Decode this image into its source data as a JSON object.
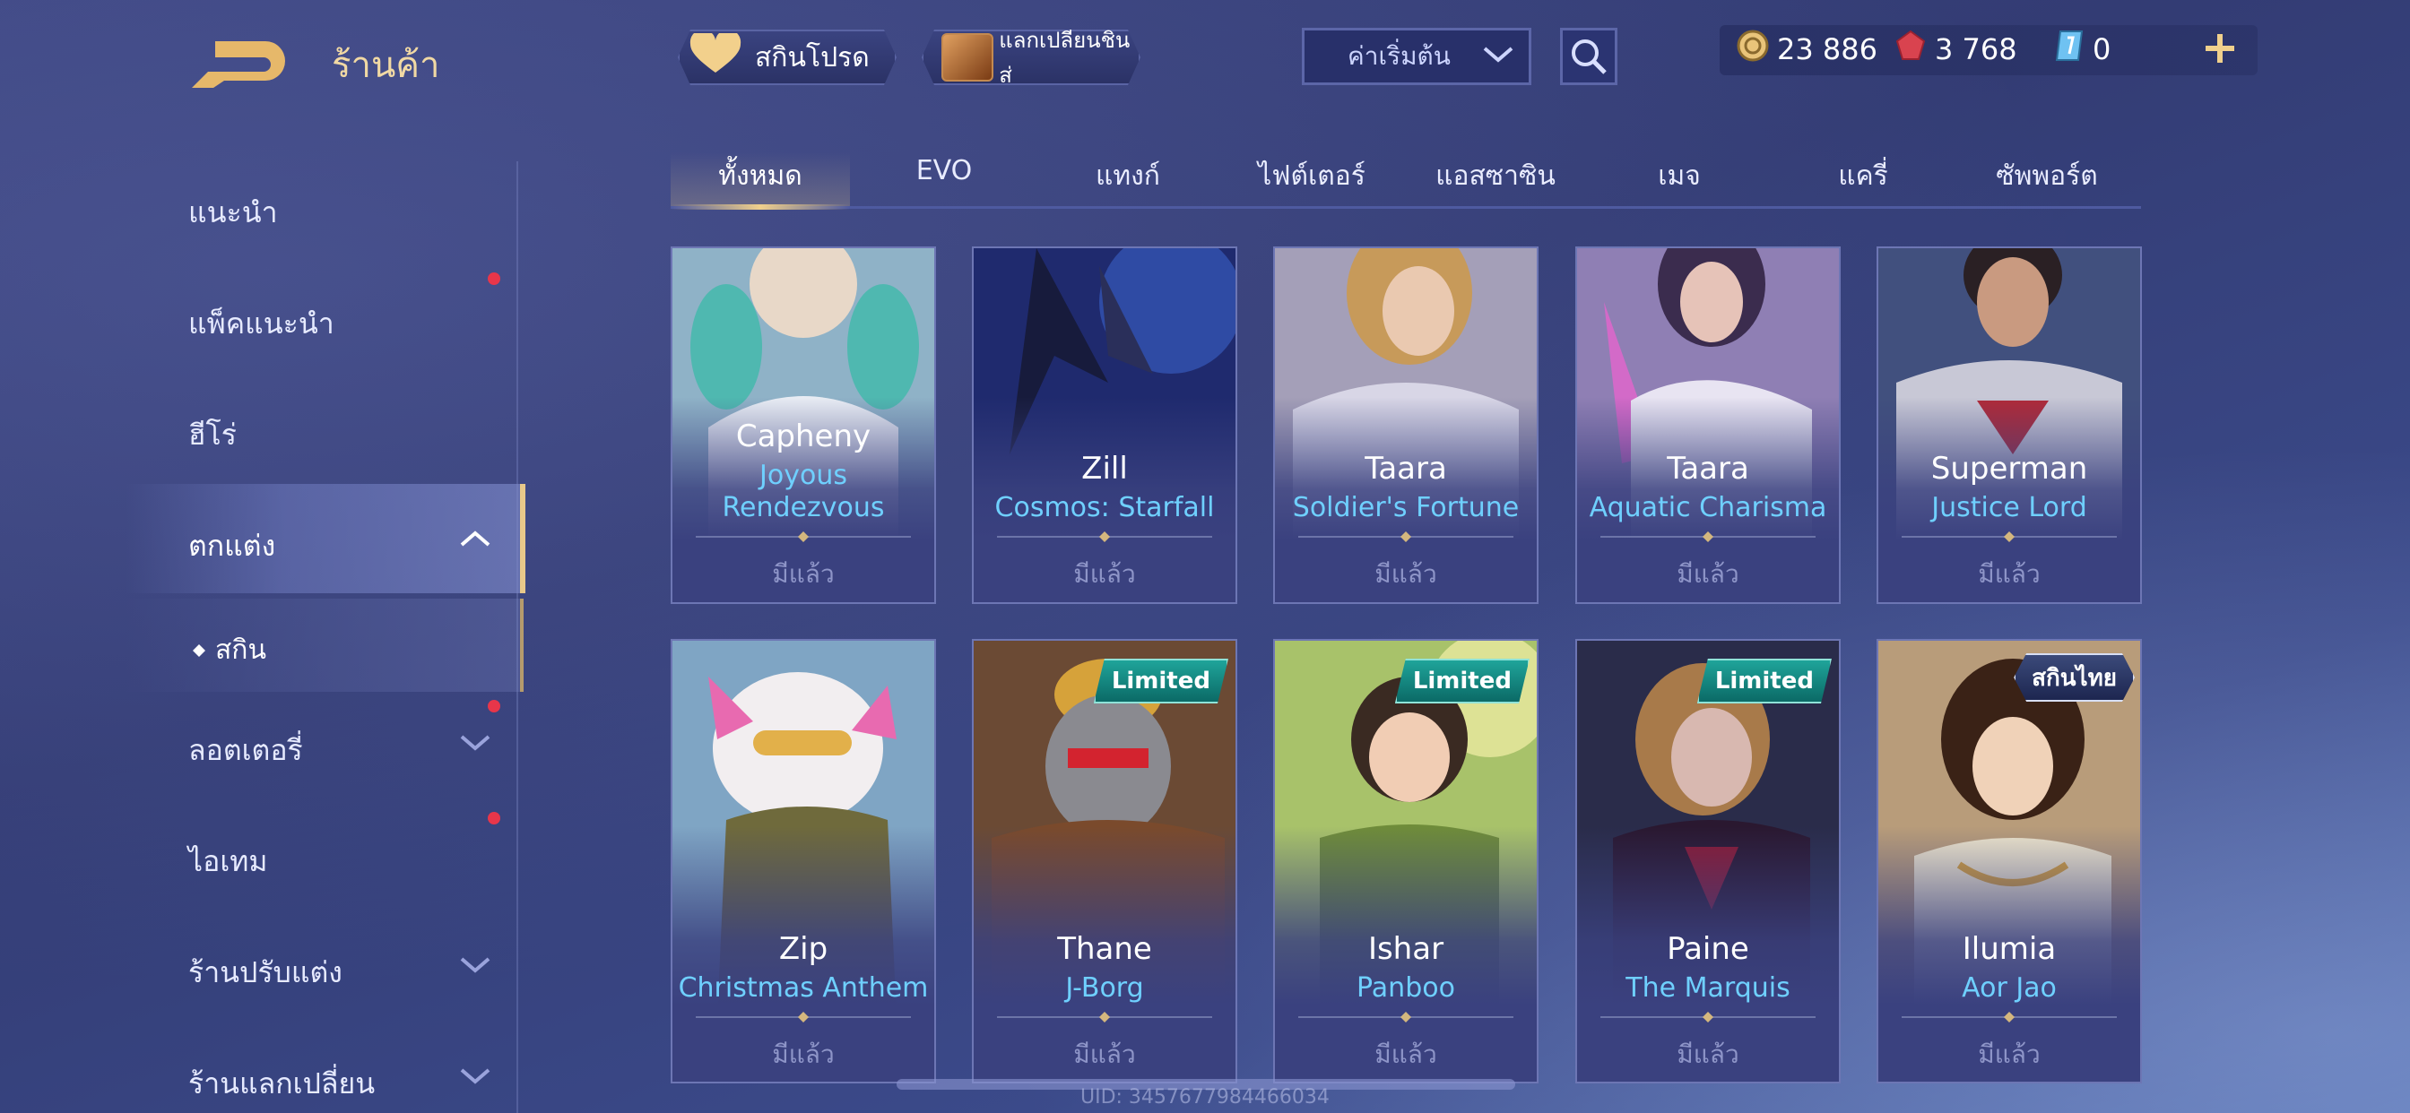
{
  "header": {
    "title": "ร้านค้า",
    "skin_pill": "สกินโปรด",
    "exchange_pill": "แลกเปลี่ยนชิ้นส่",
    "sort": {
      "selected": "ค่าเริ่มต้น"
    },
    "currencies": {
      "gold": "23 886",
      "ruby": "3 768",
      "voucher": "0"
    }
  },
  "sidebar": {
    "items": [
      {
        "label": "แนะนำ"
      },
      {
        "label": "แพ็คแนะนำ"
      },
      {
        "label": "ฮีโร่"
      },
      {
        "label": "ตกแต่ง"
      },
      {
        "label": "สกิน"
      },
      {
        "label": "ลอตเตอรี่"
      },
      {
        "label": "ไอเทม"
      },
      {
        "label": "ร้านปรับแต่ง"
      },
      {
        "label": "ร้านแลกเปลี่ยน"
      }
    ]
  },
  "tabs": [
    "ทั้งหมด",
    "EVO",
    "แทงก์",
    "ไฟต์เตอร์",
    "แอสซาซิน",
    "เมจ",
    "แครี่",
    "ซัพพอร์ต"
  ],
  "cards": [
    {
      "hero": "Capheny",
      "skin_line1": "Joyous",
      "skin_line2": "Rendezvous",
      "status": "มีแล้ว",
      "badge": ""
    },
    {
      "hero": "Zill",
      "skin_line1": "Cosmos: Starfall",
      "skin_line2": "",
      "status": "มีแล้ว",
      "badge": ""
    },
    {
      "hero": "Taara",
      "skin_line1": "Soldier's Fortune",
      "skin_line2": "",
      "status": "มีแล้ว",
      "badge": ""
    },
    {
      "hero": "Taara",
      "skin_line1": "Aquatic Charisma",
      "skin_line2": "",
      "status": "มีแล้ว",
      "badge": ""
    },
    {
      "hero": "Superman",
      "skin_line1": "Justice Lord",
      "skin_line2": "",
      "status": "มีแล้ว",
      "badge": ""
    },
    {
      "hero": "Zip",
      "skin_line1": "Christmas Anthem",
      "skin_line2": "",
      "status": "มีแล้ว",
      "badge": ""
    },
    {
      "hero": "Thane",
      "skin_line1": "J-Borg",
      "skin_line2": "",
      "status": "มีแล้ว",
      "badge": "Limited"
    },
    {
      "hero": "Ishar",
      "skin_line1": "Panboo",
      "skin_line2": "",
      "status": "มีแล้ว",
      "badge": "Limited"
    },
    {
      "hero": "Paine",
      "skin_line1": "The Marquis",
      "skin_line2": "",
      "status": "มีแล้ว",
      "badge": "Limited"
    },
    {
      "hero": "Ilumia",
      "skin_line1": "Aor Jao",
      "skin_line2": "",
      "status": "มีแล้ว",
      "badge": "สกินไทย"
    }
  ],
  "footer": {
    "uid": "UID: 3457677984466034"
  },
  "colors": {
    "accent_gold": "#f0d08c",
    "skin_name_blue": "#6fd0ff",
    "notification_red": "#e7364a",
    "limited_teal": "#1fa49a"
  }
}
